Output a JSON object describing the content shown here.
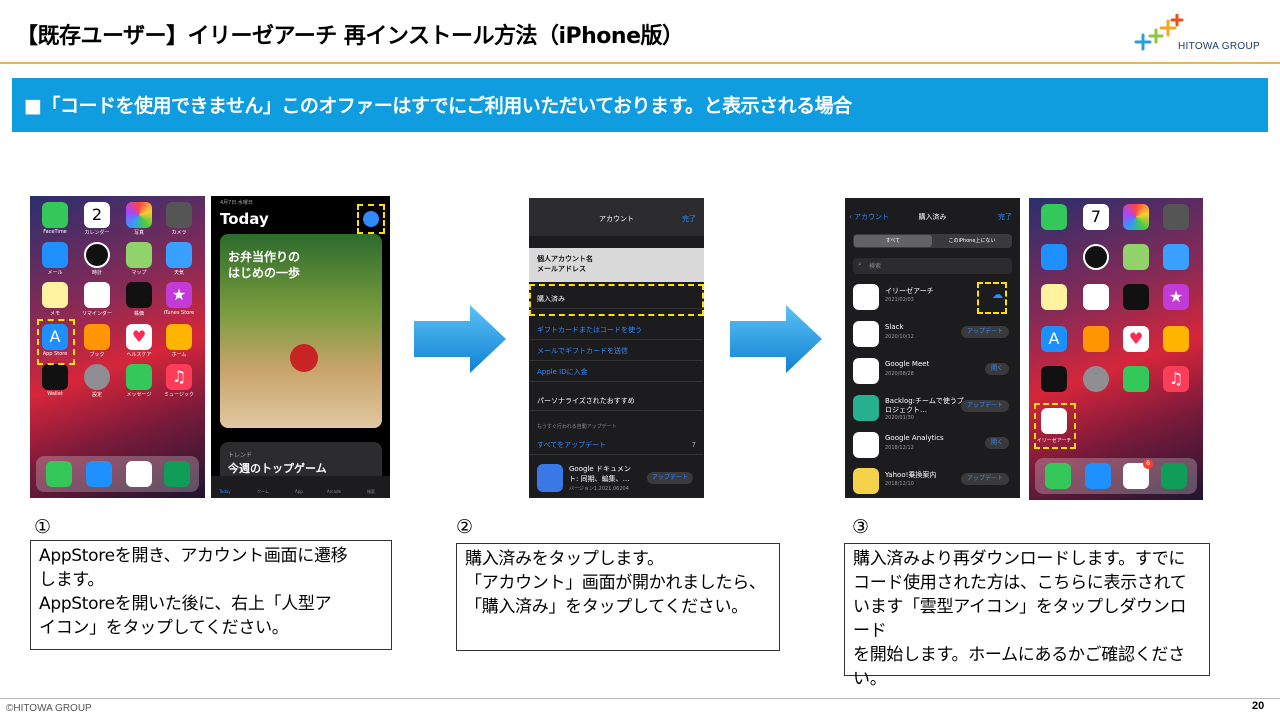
{
  "header": {
    "title": "【既存ユーザー】イリーゼアーチ 再インストール方法（iPhone版）",
    "logo_text": "HITOWA GROUP"
  },
  "banner": {
    "text": "■「コードを使用できません」このオファーはすでにご利用いただいております。と表示される場合"
  },
  "steps": [
    {
      "number": "①",
      "lines": [
        "AppStoreを開き、アカウント画面に遷移",
        "します。",
        "AppStoreを開いた後に、右上「人型ア",
        "イコン」をタップしてください。"
      ]
    },
    {
      "number": "②",
      "lines": [
        "購入済みをタップします。",
        "「アカウント」画面が開かれましたら、",
        "「購入済み」をタップしてください。"
      ]
    },
    {
      "number": "③",
      "lines": [
        "購入済みより再ダウンロードします。すでに",
        "コード使用された方は、こちらに表示されて",
        "います「雲型アイコン」をタップしダウンロード",
        "を開始します。ホームにあるかご確認くださ",
        "い。"
      ]
    }
  ],
  "screens": {
    "home1_apps": [
      "FaceTime",
      "カレンダー",
      "写真",
      "カメラ",
      "メール",
      "時計",
      "マップ",
      "天気",
      "メモ",
      "リマインダー",
      "株価",
      "iTunes Store",
      "App Store",
      "ブック",
      "ヘルスケア",
      "ホーム",
      "Wallet",
      "設定",
      "メッセージ",
      "ミュージック"
    ],
    "calendar_day_1": "2",
    "calendar_day_2": "7",
    "today": {
      "date": "4月7日 水曜日",
      "title": "Today",
      "card_text_1": "お弁当作りの",
      "card_text_2": "はじめの一歩",
      "trend_label": "トレンド",
      "trend_title": "今週のトップゲーム",
      "tabs": [
        "Today",
        "ゲーム",
        "App",
        "Arcade",
        "検索"
      ]
    },
    "account": {
      "title": "アカウント",
      "done": "完了",
      "name": "個人アカウント名",
      "email": "メールアドレス",
      "purchased": "購入済み",
      "gift": "ギフトカードまたはコードを使う",
      "send_gift": "メールでギフトカードを送信",
      "add_apple_id": "Apple IDに入金",
      "personalized": "パーソナライズされたおすすめ",
      "upcoming": "もうすぐ行われる自動アップデート",
      "update_all": "すべてをアップデート",
      "update_count": "7",
      "gdoc_name": "Google ドキュメン",
      "gdoc_sub": "ト: 同期、編集、…",
      "gdoc_ver": "バージョン1.2021.06204",
      "update_btn": "アップデート"
    },
    "purchased": {
      "back": "アカウント",
      "title": "購入済み",
      "done": "完了",
      "seg_all": "すべて",
      "seg_not_on": "このiPhone上にない",
      "search": "検索",
      "apps": [
        {
          "name": "イリーゼアーチ",
          "date": "2021/02/03",
          "btn": "",
          "color": "#ffffff"
        },
        {
          "name": "Slack",
          "date": "2020/10/12",
          "btn": "アップデート",
          "color": "#ffffff"
        },
        {
          "name": "Google Meet",
          "date": "2020/08/28",
          "btn": "開く",
          "color": "#ffffff"
        },
        {
          "name": "Backlog:チームで使うプロジェクト…",
          "date": "2020/01/30",
          "btn": "アップデート",
          "color": "#26b08f"
        },
        {
          "name": "Google Analytics",
          "date": "2018/12/12",
          "btn": "開く",
          "color": "#ffffff"
        },
        {
          "name": "Yahoo!乗換案内",
          "date": "2018/12/10",
          "btn": "アップデート",
          "color": "#f4d24a"
        }
      ]
    },
    "home2_label": "イリーゼアーチ",
    "gmail_badge": "6"
  },
  "footer": {
    "copyright": "©HITOWA GROUP",
    "page_number": "20"
  },
  "colors": {
    "banner": "#0f9de0",
    "title_rule": "#e8b84a",
    "arrow": "#1a9ae3",
    "highlight": "#ffe000"
  }
}
